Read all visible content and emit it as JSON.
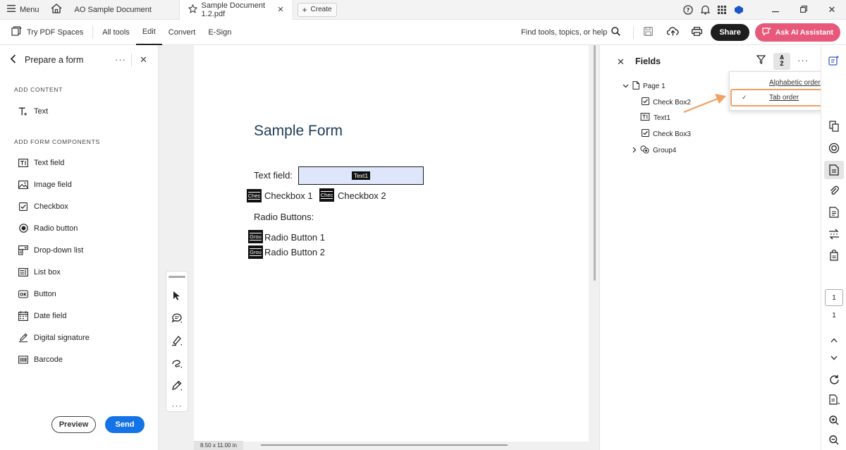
{
  "titlebar": {
    "menu_label": "Menu",
    "tabs": [
      {
        "label": "AO Sample Document",
        "active": false
      },
      {
        "label": "Sample Document 1.2.pdf",
        "active": true
      }
    ],
    "create_label": "Create"
  },
  "toolbar": {
    "try_pdf_spaces": "Try PDF Spaces",
    "items": [
      "All tools",
      "Edit",
      "Convert",
      "E-Sign"
    ],
    "active_item": "Edit",
    "find_placeholder": "Find tools, topics, or help",
    "share_label": "Share",
    "ask_ai_label": "Ask AI Assistant"
  },
  "left_panel": {
    "title": "Prepare a form",
    "add_content_header": "ADD CONTENT",
    "add_content_items": [
      {
        "label": "Text",
        "icon": "text-add-icon"
      }
    ],
    "form_components_header": "ADD FORM COMPONENTS",
    "form_components": [
      {
        "label": "Text field",
        "icon": "text-field-icon"
      },
      {
        "label": "Image field",
        "icon": "image-field-icon"
      },
      {
        "label": "Checkbox",
        "icon": "checkbox-icon"
      },
      {
        "label": "Radio button",
        "icon": "radio-button-icon"
      },
      {
        "label": "Drop-down list",
        "icon": "dropdown-list-icon"
      },
      {
        "label": "List box",
        "icon": "list-box-icon"
      },
      {
        "label": "Button",
        "icon": "button-ok-icon"
      },
      {
        "label": "Date field",
        "icon": "date-field-icon"
      },
      {
        "label": "Digital signature",
        "icon": "digital-signature-icon"
      },
      {
        "label": "Barcode",
        "icon": "barcode-icon"
      }
    ],
    "preview_label": "Preview",
    "send_label": "Send"
  },
  "document": {
    "form_title": "Sample Form",
    "text_field_label": "Text field:",
    "text_field_tag": "Text1",
    "checkbox_tag": "Chec",
    "checkbox1_label": "Checkbox 1",
    "checkbox2_label": "Checkbox 2",
    "radio_header": "Radio Buttons:",
    "radio_tag": "Grou",
    "radio1_label": "Radio Button 1",
    "radio2_label": "Radio Button 2",
    "page_size": "8.50 x 11.00 in"
  },
  "fields_panel": {
    "title": "Fields",
    "tree": {
      "page": "Page 1",
      "items": [
        {
          "label": "Check Box2",
          "icon": "checkbox-icon"
        },
        {
          "label": "Text1",
          "icon": "text-field-icon"
        },
        {
          "label": "Check Box3",
          "icon": "checkbox-icon"
        },
        {
          "label": "Group4",
          "icon": "radio-group-icon"
        }
      ]
    },
    "sort_menu": {
      "options": [
        "Alphabetic order",
        "Tab order"
      ],
      "selected": "Tab order"
    }
  },
  "rail": {
    "current_page": "1",
    "total_pages": "1"
  },
  "colors": {
    "accent_blue": "#1473e6",
    "ai_pink": "#e8587a",
    "highlight_orange": "#f0a060",
    "form_title_blue": "#1f3b57"
  }
}
